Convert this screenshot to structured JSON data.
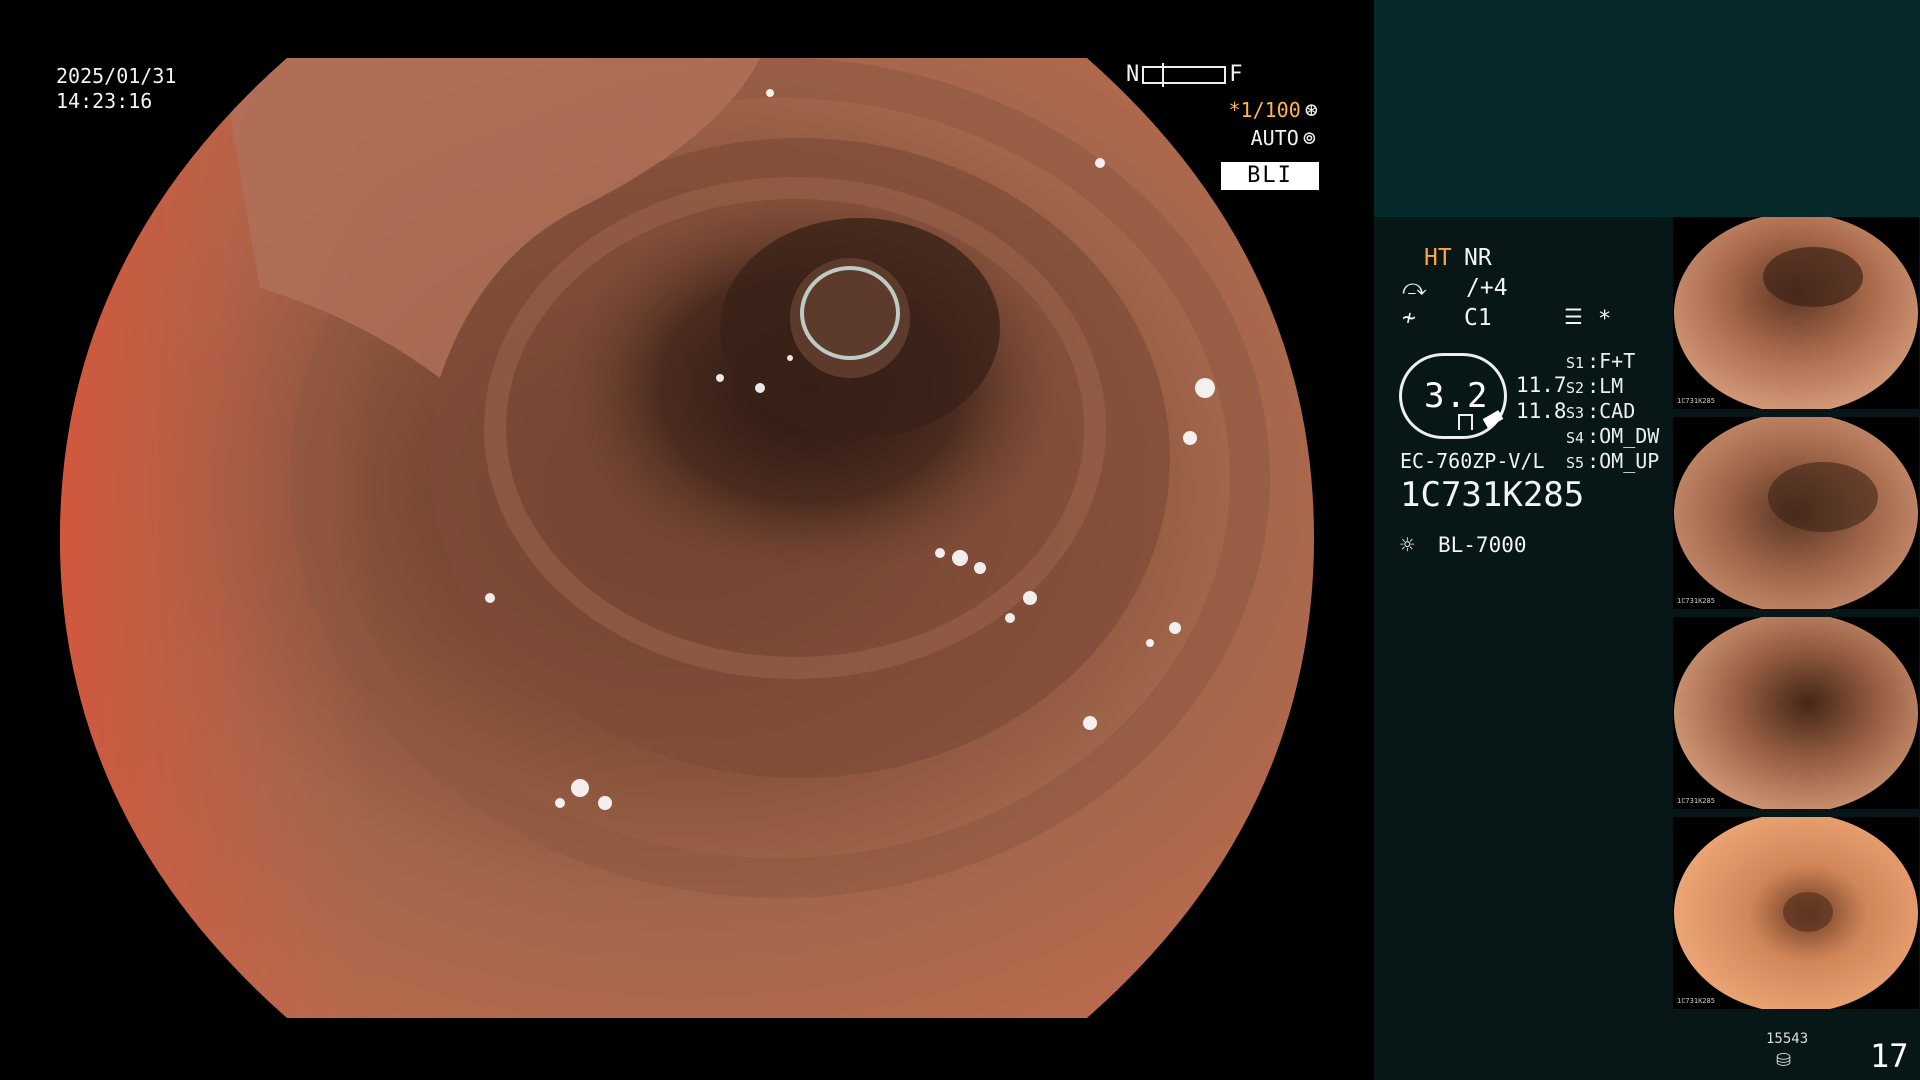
{
  "overlay": {
    "date": "2025/01/31",
    "time": "14:23:16",
    "near_label": "N",
    "far_label": "F",
    "shutter": "*1/100",
    "shutter_icon": "aperture-icon",
    "auto": "AUTO",
    "auto_icon": "iris-icon",
    "mode": "BLI"
  },
  "status": {
    "ht": "HT",
    "nr": "NR",
    "enhance": "/+4",
    "color": "C1",
    "star": "*",
    "zoom": "3.2",
    "val1": "11.7",
    "val2": "11.8",
    "softkeys": [
      {
        "key": "S1",
        "label": "F+T"
      },
      {
        "key": "S2",
        "label": "LM"
      },
      {
        "key": "S3",
        "label": "CAD"
      },
      {
        "key": "S4",
        "label": "OM_DW"
      },
      {
        "key": "S5",
        "label": "OM_UP"
      }
    ],
    "scope_model": "EC-760ZP-V/L",
    "serial": "1C731K285",
    "light_source": "BL-7000",
    "image_count": "15543",
    "page": "17"
  },
  "colors": {
    "panel_top": "#06292a",
    "panel": "#071616",
    "accent_orange": "#ffa53a",
    "mucosa": "#b86a4d"
  },
  "thumbnails": [
    {
      "caption": "1C731K285"
    },
    {
      "caption": "1C731K285"
    },
    {
      "caption": "1C731K285"
    },
    {
      "caption": "1C731K285"
    }
  ]
}
